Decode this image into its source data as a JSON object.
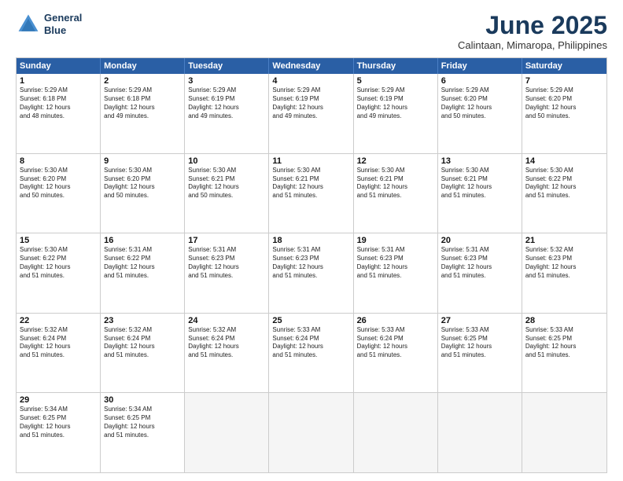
{
  "header": {
    "logo_line1": "General",
    "logo_line2": "Blue",
    "month_year": "June 2025",
    "location": "Calintaan, Mimaropa, Philippines"
  },
  "weekdays": [
    "Sunday",
    "Monday",
    "Tuesday",
    "Wednesday",
    "Thursday",
    "Friday",
    "Saturday"
  ],
  "rows": [
    [
      {
        "day": "",
        "info": ""
      },
      {
        "day": "2",
        "info": "Sunrise: 5:29 AM\nSunset: 6:18 PM\nDaylight: 12 hours\nand 49 minutes."
      },
      {
        "day": "3",
        "info": "Sunrise: 5:29 AM\nSunset: 6:19 PM\nDaylight: 12 hours\nand 49 minutes."
      },
      {
        "day": "4",
        "info": "Sunrise: 5:29 AM\nSunset: 6:19 PM\nDaylight: 12 hours\nand 49 minutes."
      },
      {
        "day": "5",
        "info": "Sunrise: 5:29 AM\nSunset: 6:19 PM\nDaylight: 12 hours\nand 49 minutes."
      },
      {
        "day": "6",
        "info": "Sunrise: 5:29 AM\nSunset: 6:20 PM\nDaylight: 12 hours\nand 50 minutes."
      },
      {
        "day": "7",
        "info": "Sunrise: 5:29 AM\nSunset: 6:20 PM\nDaylight: 12 hours\nand 50 minutes."
      }
    ],
    [
      {
        "day": "1",
        "info": "Sunrise: 5:29 AM\nSunset: 6:18 PM\nDaylight: 12 hours\nand 48 minutes."
      },
      {
        "day": "",
        "info": ""
      },
      {
        "day": "",
        "info": ""
      },
      {
        "day": "",
        "info": ""
      },
      {
        "day": "",
        "info": ""
      },
      {
        "day": "",
        "info": ""
      },
      {
        "day": "",
        "info": ""
      }
    ],
    [
      {
        "day": "8",
        "info": "Sunrise: 5:30 AM\nSunset: 6:20 PM\nDaylight: 12 hours\nand 50 minutes."
      },
      {
        "day": "9",
        "info": "Sunrise: 5:30 AM\nSunset: 6:20 PM\nDaylight: 12 hours\nand 50 minutes."
      },
      {
        "day": "10",
        "info": "Sunrise: 5:30 AM\nSunset: 6:21 PM\nDaylight: 12 hours\nand 50 minutes."
      },
      {
        "day": "11",
        "info": "Sunrise: 5:30 AM\nSunset: 6:21 PM\nDaylight: 12 hours\nand 51 minutes."
      },
      {
        "day": "12",
        "info": "Sunrise: 5:30 AM\nSunset: 6:21 PM\nDaylight: 12 hours\nand 51 minutes."
      },
      {
        "day": "13",
        "info": "Sunrise: 5:30 AM\nSunset: 6:21 PM\nDaylight: 12 hours\nand 51 minutes."
      },
      {
        "day": "14",
        "info": "Sunrise: 5:30 AM\nSunset: 6:22 PM\nDaylight: 12 hours\nand 51 minutes."
      }
    ],
    [
      {
        "day": "15",
        "info": "Sunrise: 5:30 AM\nSunset: 6:22 PM\nDaylight: 12 hours\nand 51 minutes."
      },
      {
        "day": "16",
        "info": "Sunrise: 5:31 AM\nSunset: 6:22 PM\nDaylight: 12 hours\nand 51 minutes."
      },
      {
        "day": "17",
        "info": "Sunrise: 5:31 AM\nSunset: 6:23 PM\nDaylight: 12 hours\nand 51 minutes."
      },
      {
        "day": "18",
        "info": "Sunrise: 5:31 AM\nSunset: 6:23 PM\nDaylight: 12 hours\nand 51 minutes."
      },
      {
        "day": "19",
        "info": "Sunrise: 5:31 AM\nSunset: 6:23 PM\nDaylight: 12 hours\nand 51 minutes."
      },
      {
        "day": "20",
        "info": "Sunrise: 5:31 AM\nSunset: 6:23 PM\nDaylight: 12 hours\nand 51 minutes."
      },
      {
        "day": "21",
        "info": "Sunrise: 5:32 AM\nSunset: 6:23 PM\nDaylight: 12 hours\nand 51 minutes."
      }
    ],
    [
      {
        "day": "22",
        "info": "Sunrise: 5:32 AM\nSunset: 6:24 PM\nDaylight: 12 hours\nand 51 minutes."
      },
      {
        "day": "23",
        "info": "Sunrise: 5:32 AM\nSunset: 6:24 PM\nDaylight: 12 hours\nand 51 minutes."
      },
      {
        "day": "24",
        "info": "Sunrise: 5:32 AM\nSunset: 6:24 PM\nDaylight: 12 hours\nand 51 minutes."
      },
      {
        "day": "25",
        "info": "Sunrise: 5:33 AM\nSunset: 6:24 PM\nDaylight: 12 hours\nand 51 minutes."
      },
      {
        "day": "26",
        "info": "Sunrise: 5:33 AM\nSunset: 6:24 PM\nDaylight: 12 hours\nand 51 minutes."
      },
      {
        "day": "27",
        "info": "Sunrise: 5:33 AM\nSunset: 6:25 PM\nDaylight: 12 hours\nand 51 minutes."
      },
      {
        "day": "28",
        "info": "Sunrise: 5:33 AM\nSunset: 6:25 PM\nDaylight: 12 hours\nand 51 minutes."
      }
    ],
    [
      {
        "day": "29",
        "info": "Sunrise: 5:34 AM\nSunset: 6:25 PM\nDaylight: 12 hours\nand 51 minutes."
      },
      {
        "day": "30",
        "info": "Sunrise: 5:34 AM\nSunset: 6:25 PM\nDaylight: 12 hours\nand 51 minutes."
      },
      {
        "day": "",
        "info": ""
      },
      {
        "day": "",
        "info": ""
      },
      {
        "day": "",
        "info": ""
      },
      {
        "day": "",
        "info": ""
      },
      {
        "day": "",
        "info": ""
      }
    ]
  ]
}
